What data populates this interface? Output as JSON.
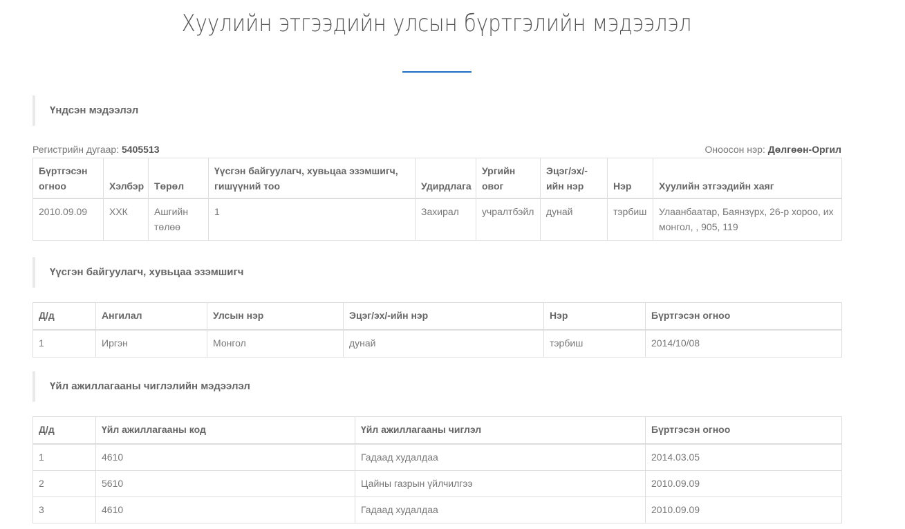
{
  "page": {
    "title": "Хуулийн этгээдийн улсын бүртгэлийн мэдээлэл"
  },
  "basic": {
    "heading": "Үндсэн мэдээлэл",
    "reg_label": "Регистрийн дугаар:",
    "reg_value": "5405513",
    "name_label": "Оноосон нэр:",
    "name_value": "Дөлгөөн-Оргил",
    "columns": [
      "Бүртгэсэн огноо",
      "Хэлбэр",
      "Төрөл",
      "Үүсгэн байгуулагч, хувьцаа эзэмшигч, гишүүний тоо",
      "Удирдлага",
      "Ургийн овог",
      "Эцэг/эх/-ийн нэр",
      "Нэр",
      "Хуулийн этгээдийн хаяг"
    ],
    "row": [
      "2010.09.09",
      "ХХК",
      "Ашгийн төлөө",
      "1",
      "Захирал",
      "учралтбэйл",
      "дунай",
      "тэрбиш",
      "Улаанбаатар, Баянзүрх, 26-р хороо, их монгол, , 905, 119"
    ]
  },
  "founders": {
    "heading": "Үүсгэн байгуулагч, хувьцаа эзэмшигч",
    "columns": [
      "Д/д",
      "Ангилал",
      "Улсын нэр",
      "Эцэг/эх/-ийн нэр",
      "Нэр",
      "Бүртгэсэн огноо"
    ],
    "rows": [
      [
        "1",
        "Иргэн",
        "Монгол",
        "дунай",
        "тэрбиш",
        "2014/10/08"
      ]
    ]
  },
  "activity": {
    "heading": "Үйл ажиллагааны чиглэлийн мэдээлэл",
    "columns": [
      "Д/д",
      "Үйл ажиллагааны код",
      "Үйл ажиллагааны чиглэл",
      "Бүртгэсэн огноо"
    ],
    "rows": [
      [
        "1",
        "4610",
        "Гадаад худалдаа",
        "2014.03.05"
      ],
      [
        "2",
        "5610",
        "Цайны газрын үйлчилгээ",
        "2010.09.09"
      ],
      [
        "3",
        "4610",
        "Гадаад худалдаа",
        "2010.09.09"
      ]
    ]
  },
  "colors": {
    "accent": "#1a6fc4",
    "text": "#666666",
    "border": "#dddddd"
  }
}
